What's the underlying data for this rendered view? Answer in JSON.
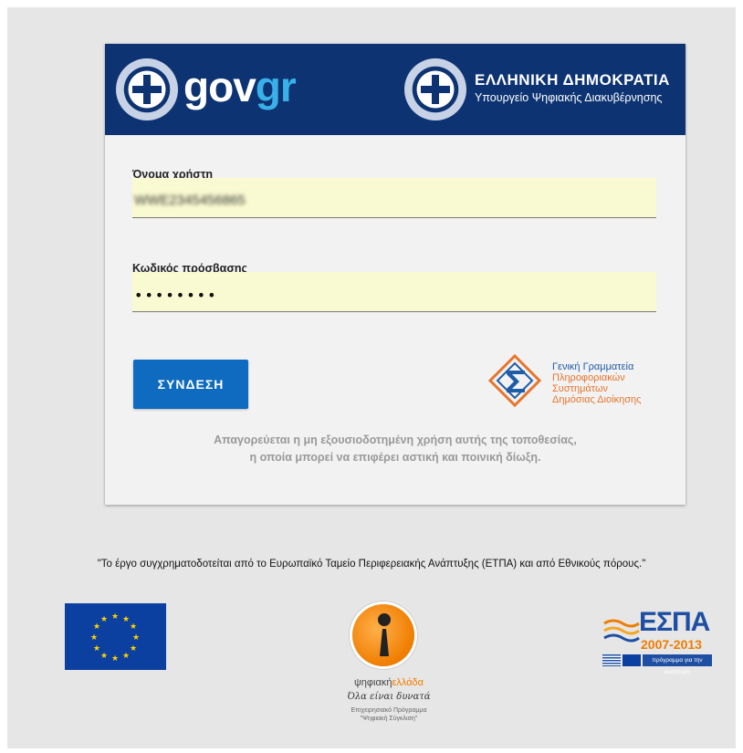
{
  "header": {
    "brand_prefix": "gov",
    "brand_suffix": "gr",
    "ministry_title": "ΕΛΛΗΝΙΚΗ ΔΗΜΟΚΡΑΤΙΑ",
    "ministry_subtitle": "Υπουργείο Ψηφιακής Διακυβέρνησης"
  },
  "login_form": {
    "username_label": "Όνομα χρήστη",
    "username_value": "WWE2345456865",
    "password_label": "Κωδικός πρόσβασης",
    "password_masked": "••••••••",
    "submit_label": "ΣΥΝΔΕΣΗ"
  },
  "gsis_logo": {
    "line1": "Γενική Γραμματεία",
    "line2": "Πληροφοριακών",
    "line3": "Συστημάτων",
    "line4": "Δημόσιας Διοίκησης"
  },
  "warning": {
    "line1": "Απαγορεύεται η μη εξουσιοδοτημένη χρήση αυτής της τοποθεσίας,",
    "line2": "η οποία μπορεί να επιφέρει αστική και ποινική δίωξη."
  },
  "footer": {
    "funding_note": "\"Το έργο συγχρηματοδοτείται από το Ευρωπαϊκό Ταμείο Περιφερειακής Ανάπτυξης (ΕΤΠΑ) και από Εθνικούς πόρους.\"",
    "digital_greece": {
      "name_start": "ψηφιακή",
      "name_highlight": "ελλάδα",
      "slogan": "Όλα είναι δυνατά",
      "program_line1": "Επιχειρησιακό Πρόγραμμα",
      "program_line2": "\"Ψηφιακή Σύγκλιση\""
    },
    "espa": {
      "title": "ΕΣΠΑ",
      "years": "2007-2013",
      "tagline": "πρόγραμμα για την ανάπτυξη"
    }
  },
  "colors": {
    "header_bg": "#0d3372",
    "brand_accent": "#39b0e8",
    "button_bg": "#0e6bbf",
    "field_bg": "#fafad2",
    "orange": "#ef7d00"
  }
}
